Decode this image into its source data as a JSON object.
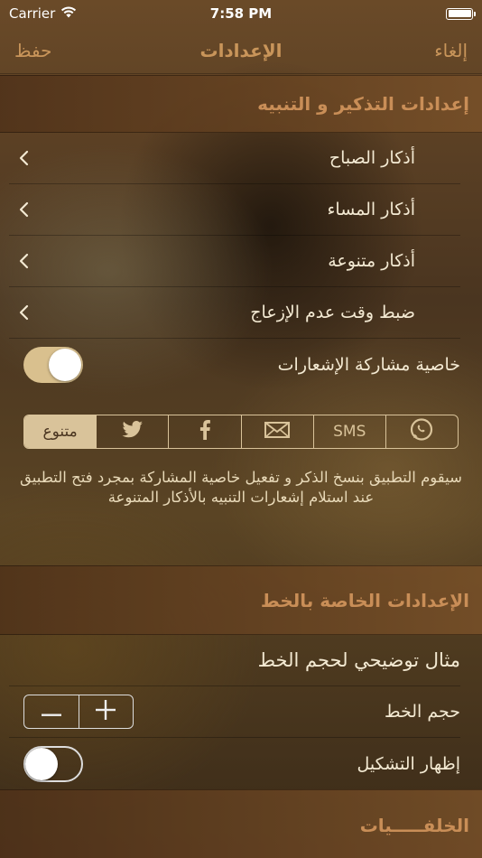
{
  "status_bar": {
    "carrier": "Carrier",
    "time": "7:58 PM"
  },
  "nav": {
    "save": "حفظ",
    "title": "الإعدادات",
    "cancel": "إلغاء"
  },
  "reminders_section": {
    "header": "إعدادات التذكير و التنبيه",
    "items": [
      {
        "label": "أذكار الصباح"
      },
      {
        "label": "أذكار المساء"
      },
      {
        "label": "أذكار متنوعة"
      },
      {
        "label": "ضبط وقت عدم الإزعاج"
      }
    ],
    "share_notifications": {
      "label": "خاصية مشاركة الإشعارات",
      "enabled": true
    },
    "share_targets": [
      "متنوع",
      "twitter-icon",
      "facebook-icon",
      "mail-icon",
      "SMS",
      "whatsapp-icon"
    ],
    "share_selected": "متنوع",
    "sms_label": "SMS",
    "various_label": "متنوع",
    "info_text": "سيقوم التطبيق بنسخ الذكر و تفعيل خاصية المشاركة بمجرد فتح التطبيق عند استلام إشعارات التنبيه بالأذكار المتنوعة"
  },
  "font_section": {
    "header": "الإعدادات الخاصة بالخط",
    "sample": "مثال توضيحي لحجم الخط",
    "font_size_label": "حجم الخط",
    "show_diacritics": {
      "label": "إظهار التشكيل",
      "enabled": false
    }
  },
  "backgrounds_section": {
    "header": "الخلفـــــيات"
  },
  "colors": {
    "accent": "#c9955a",
    "toggle_on": "#d9c08e",
    "segment": "#d9c39a"
  }
}
